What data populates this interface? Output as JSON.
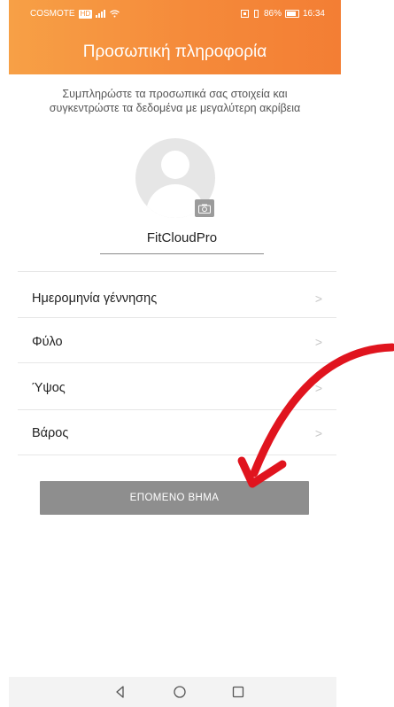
{
  "status_bar": {
    "carrier": "COSMOTE",
    "carrier_badge": "HD",
    "battery_percent": "86%",
    "time": "16:34"
  },
  "header": {
    "title": "Προσωπική πληροφορία"
  },
  "intro": {
    "line1": "Συμπληρώστε τα προσωπικά σας στοιχεία και",
    "line2": "συγκεντρώστε τα δεδομένα με μεγαλύτερη ακρίβεια"
  },
  "profile": {
    "name": "FitCloudPro"
  },
  "fields": [
    {
      "label": "Ημερομηνία γέννησης",
      "chevron": ">"
    },
    {
      "label": "Φύλο",
      "chevron": ">"
    },
    {
      "label": "Ύψος",
      "chevron": ">"
    },
    {
      "label": "Βάρος",
      "chevron": ">"
    }
  ],
  "next_button": {
    "label": "ΕΠΟΜΕΝΟ ΒΗΜΑ"
  },
  "colors": {
    "header_orange": "#f58a3a",
    "button_gray": "#8e8e8e",
    "arrow_red": "#e0141e"
  },
  "nav_icons": [
    "back-icon",
    "home-icon",
    "recents-icon"
  ]
}
